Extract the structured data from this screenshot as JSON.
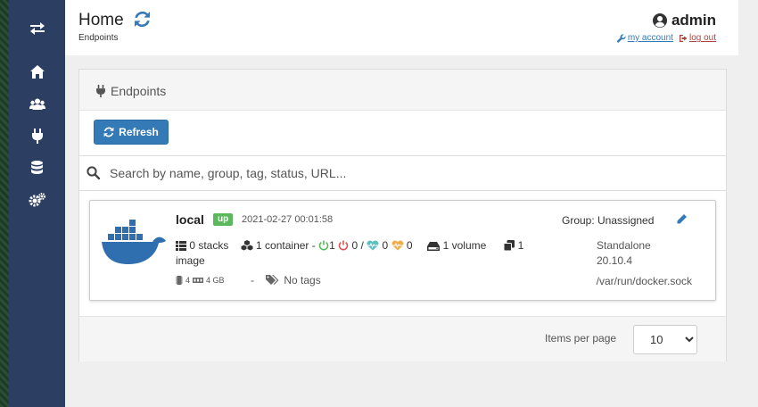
{
  "header": {
    "title": "Home",
    "breadcrumb": "Endpoints",
    "username": "admin",
    "my_account": "my account",
    "log_out": "log out"
  },
  "sidebar": {
    "items": [
      {
        "icon": "transfer-icon"
      },
      {
        "icon": "home-icon"
      },
      {
        "icon": "users-icon"
      },
      {
        "icon": "plug-icon"
      },
      {
        "icon": "database-icon"
      },
      {
        "icon": "cogs-icon"
      }
    ]
  },
  "widget": {
    "title": "Endpoints",
    "refresh_label": "Refresh",
    "search_placeholder": "Search by name, group, tag, status, URL..."
  },
  "endpoint": {
    "name": "local",
    "status": "up",
    "timestamp": "2021-02-27 00:01:58",
    "group": "Group: Unassigned",
    "stacks": "0 stacks",
    "containers": "1 container -",
    "running": "1",
    "stopped": "0",
    "separator": "/",
    "healthy": "0",
    "unhealthy": "0",
    "volumes": "1 volume",
    "images": "1",
    "image_word": "image",
    "type": "Standalone",
    "version": "20.10.4",
    "cpu": "4",
    "memory": "4 GB",
    "dash": "-",
    "tags": "No tags",
    "socket": "/var/run/docker.sock"
  },
  "pager": {
    "label": "Items per page",
    "selected": "10"
  },
  "colors": {
    "sidebar": "#2d3e63",
    "primary": "#337ab7",
    "up_badge": "#5cb85c",
    "running": "#5cb85c",
    "stopped": "#d9534f",
    "healthy": "#5bc0be",
    "unhealthy": "#f0ad4e"
  }
}
